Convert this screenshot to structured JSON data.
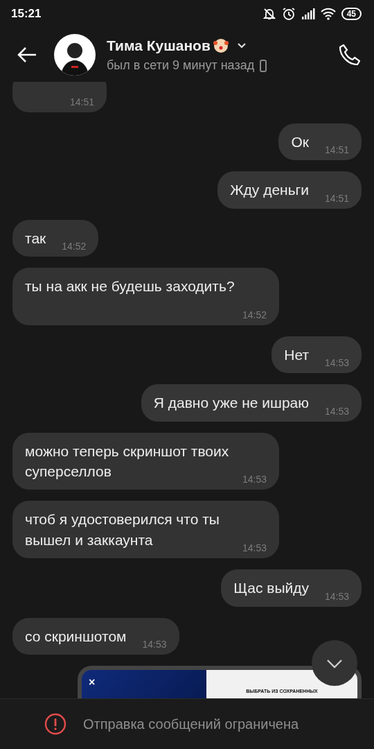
{
  "status_bar": {
    "time": "15:21",
    "battery": "45"
  },
  "header": {
    "name": "Тима Кушанов",
    "status": "был в сети 9 минут назад"
  },
  "messages": [
    {
      "kind": "in",
      "time": "14:51",
      "cut": true
    },
    {
      "kind": "out",
      "text": "Ок",
      "time": "14:51"
    },
    {
      "kind": "out",
      "text": "Жду деньги",
      "time": "14:51"
    },
    {
      "kind": "in",
      "text": "так",
      "time": "14:52"
    },
    {
      "kind": "in",
      "text": "ты на акк не будешь заходить?",
      "time": "14:52"
    },
    {
      "kind": "out",
      "text": "Нет",
      "time": "14:53"
    },
    {
      "kind": "out",
      "text": "Я давно уже не ишраю",
      "time": "14:53"
    },
    {
      "kind": "in",
      "text": "можно теперь скриншот твоих суперселлов",
      "time": "14:53"
    },
    {
      "kind": "in",
      "text": "чтоб я удостоверился что ты вышел и заккаунта",
      "time": "14:53"
    },
    {
      "kind": "out",
      "text": "Щас выйду",
      "time": "14:53"
    },
    {
      "kind": "in",
      "text": "со скриншотом",
      "time": "14:53"
    }
  ],
  "attachment_preview": {
    "close": "×",
    "caption": "ВЫБРАТЬ ИЗ СОХРАНЕННЫХ"
  },
  "footer": {
    "notice": "Отправка сообщений ограничена"
  }
}
